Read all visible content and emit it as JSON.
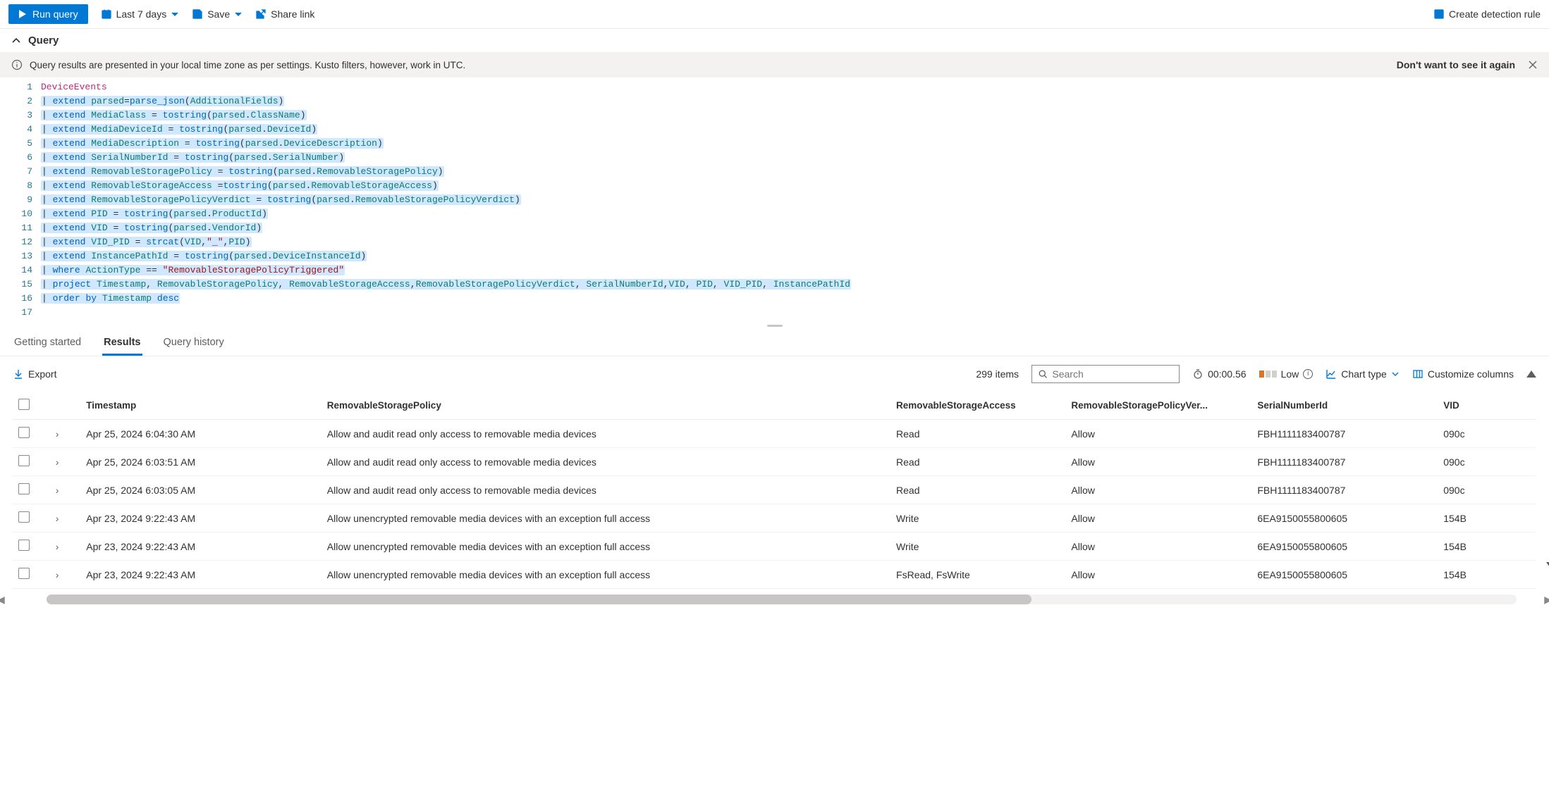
{
  "toolbar": {
    "run_label": "Run query",
    "time_range_label": "Last 7 days",
    "save_label": "Save",
    "share_label": "Share link",
    "create_rule_label": "Create detection rule"
  },
  "query_section": {
    "title": "Query"
  },
  "banner": {
    "message": "Query results are presented in your local time zone as per settings. Kusto filters, however, work in UTC.",
    "dismiss_label": "Don't want to see it again"
  },
  "code": {
    "lines": [
      {
        "n": 1,
        "plain": "DeviceEvents"
      },
      {
        "n": 2,
        "plain": "| extend parsed=parse_json(AdditionalFields)"
      },
      {
        "n": 3,
        "plain": "| extend MediaClass = tostring(parsed.ClassName)"
      },
      {
        "n": 4,
        "plain": "| extend MediaDeviceId = tostring(parsed.DeviceId)"
      },
      {
        "n": 5,
        "plain": "| extend MediaDescription = tostring(parsed.DeviceDescription)"
      },
      {
        "n": 6,
        "plain": "| extend SerialNumberId = tostring(parsed.SerialNumber)"
      },
      {
        "n": 7,
        "plain": "| extend RemovableStoragePolicy = tostring(parsed.RemovableStoragePolicy)"
      },
      {
        "n": 8,
        "plain": "| extend RemovableStorageAccess =tostring(parsed.RemovableStorageAccess)"
      },
      {
        "n": 9,
        "plain": "| extend RemovableStoragePolicyVerdict = tostring(parsed.RemovableStoragePolicyVerdict)"
      },
      {
        "n": 10,
        "plain": "| extend PID = tostring(parsed.ProductId)"
      },
      {
        "n": 11,
        "plain": "| extend VID = tostring(parsed.VendorId)"
      },
      {
        "n": 12,
        "plain": "| extend VID_PID = strcat(VID,\"_\",PID)"
      },
      {
        "n": 13,
        "plain": "| extend InstancePathId = tostring(parsed.DeviceInstanceId)"
      },
      {
        "n": 14,
        "plain": "| where ActionType == \"RemovableStoragePolicyTriggered\""
      },
      {
        "n": 15,
        "plain": "| project Timestamp, RemovableStoragePolicy, RemovableStorageAccess,RemovableStoragePolicyVerdict, SerialNumberId,VID, PID, VID_PID, InstancePathId"
      },
      {
        "n": 16,
        "plain": "| order by Timestamp desc"
      },
      {
        "n": 17,
        "plain": ""
      }
    ]
  },
  "tabs": {
    "getting_started": "Getting started",
    "results": "Results",
    "query_history": "Query history"
  },
  "results_bar": {
    "export_label": "Export",
    "item_count_label": "299 items",
    "search_placeholder": "Search",
    "elapsed": "00:00.56",
    "memory_label": "Low",
    "chart_type_label": "Chart type",
    "customize_label": "Customize columns"
  },
  "table": {
    "columns": {
      "timestamp": "Timestamp",
      "policy": "RemovableStoragePolicy",
      "access": "RemovableStorageAccess",
      "verdict": "RemovableStoragePolicyVer...",
      "serial": "SerialNumberId",
      "vid": "VID"
    },
    "rows": [
      {
        "ts": "Apr 25, 2024 6:04:30 AM",
        "pol": "Allow and audit read only access to removable media devices",
        "acc": "Read",
        "ver": "Allow",
        "sn": "FBH1111183400787",
        "vid": "090c"
      },
      {
        "ts": "Apr 25, 2024 6:03:51 AM",
        "pol": "Allow and audit read only access to removable media devices",
        "acc": "Read",
        "ver": "Allow",
        "sn": "FBH1111183400787",
        "vid": "090c"
      },
      {
        "ts": "Apr 25, 2024 6:03:05 AM",
        "pol": "Allow and audit read only access to removable media devices",
        "acc": "Read",
        "ver": "Allow",
        "sn": "FBH1111183400787",
        "vid": "090c"
      },
      {
        "ts": "Apr 23, 2024 9:22:43 AM",
        "pol": "Allow unencrypted removable media devices with an exception full access",
        "acc": "Write",
        "ver": "Allow",
        "sn": "6EA9150055800605",
        "vid": "154B"
      },
      {
        "ts": "Apr 23, 2024 9:22:43 AM",
        "pol": "Allow unencrypted removable media devices with an exception full access",
        "acc": "Write",
        "ver": "Allow",
        "sn": "6EA9150055800605",
        "vid": "154B"
      },
      {
        "ts": "Apr 23, 2024 9:22:43 AM",
        "pol": "Allow unencrypted removable media devices with an exception full access",
        "acc": "FsRead, FsWrite",
        "ver": "Allow",
        "sn": "6EA9150055800605",
        "vid": "154B"
      }
    ]
  }
}
